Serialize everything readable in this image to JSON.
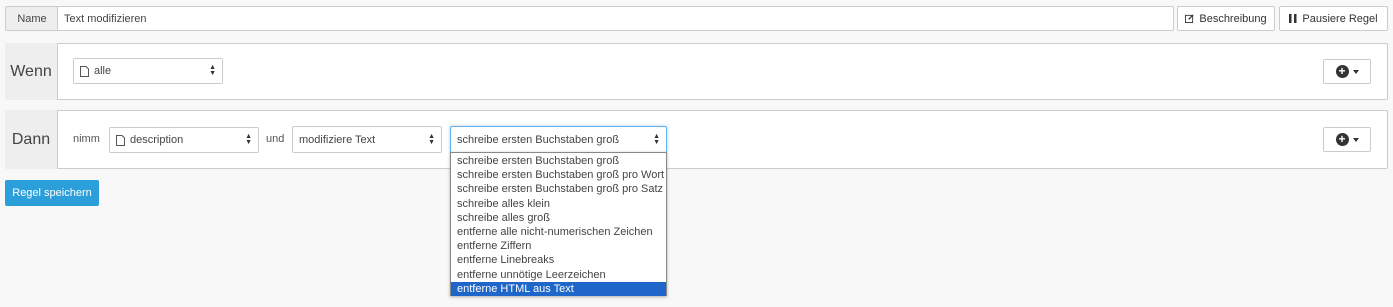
{
  "name_row": {
    "label": "Name",
    "value": "Text modifizieren",
    "description_button": "Beschreibung",
    "pause_button": "Pausiere Regel"
  },
  "wenn": {
    "label": "Wenn",
    "select_value": "alle"
  },
  "dann": {
    "label": "Dann",
    "nimm": "nimm",
    "field_select": "description",
    "und": "und",
    "action_select": "modifiziere Text",
    "operation_select": "schreibe ersten Buchstaben groß",
    "options": [
      "schreibe ersten Buchstaben groß",
      "schreibe ersten Buchstaben groß pro Wort",
      "schreibe ersten Buchstaben groß pro Satz",
      "schreibe alles klein",
      "schreibe alles groß",
      "entferne alle nicht-numerischen Zeichen",
      "entferne Ziffern",
      "entferne Linebreaks",
      "entferne unnötige Leerzeichen",
      "entferne HTML aus Text"
    ],
    "highlighted_option": "entferne HTML aus Text"
  },
  "save_button": "Regel speichern",
  "colors": {
    "primary": "#2b9fd9",
    "highlight": "#1e66c9"
  }
}
